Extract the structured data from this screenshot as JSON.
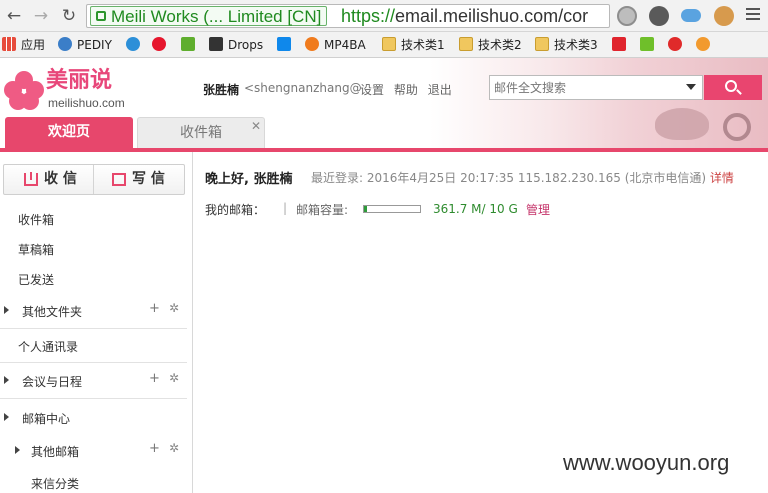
{
  "browser": {
    "ev_badge": "Meili Works (... Limited [CN]",
    "url_https": "https://",
    "url_rest": "email.meilishuo.com/cor"
  },
  "bookmarks": [
    {
      "label": "应用",
      "icon": "apps-grid-icon"
    },
    {
      "label": "PEDIY",
      "icon": "snowflake-icon"
    },
    {
      "label": "",
      "icon": "ip-icon"
    },
    {
      "label": "",
      "icon": "weibo-icon"
    },
    {
      "label": "",
      "icon": "f-icon"
    },
    {
      "label": "Drops",
      "icon": "drops-icon"
    },
    {
      "label": "",
      "icon": "zhihu-icon"
    },
    {
      "label": "MP4BA",
      "icon": "play-icon"
    },
    {
      "label": "技术类1",
      "icon": "folder-icon"
    },
    {
      "label": "技术类2",
      "icon": "folder-icon"
    },
    {
      "label": "技术类3",
      "icon": "folder-icon"
    }
  ],
  "header": {
    "logo_cn": "美丽说",
    "logo_en": "meilishuo.com",
    "user_name": "张胜楠",
    "user_email": "<shengnanzhang@",
    "links": [
      "设置",
      "帮助",
      "退出"
    ],
    "search_placeholder": "邮件全文搜索"
  },
  "tabs": [
    {
      "label": "欢迎页",
      "active": true
    },
    {
      "label": "收件箱",
      "active": false
    }
  ],
  "sidebar": {
    "receive": "收 信",
    "write": "写 信",
    "items": [
      {
        "label": "收件箱"
      },
      {
        "label": "草稿箱"
      },
      {
        "label": "已发送"
      },
      {
        "label": "其他文件夹"
      },
      {
        "label": "个人通讯录"
      },
      {
        "label": "会议与日程"
      },
      {
        "label": "邮箱中心"
      },
      {
        "label": "其他邮箱"
      },
      {
        "label": "来信分类"
      }
    ]
  },
  "main": {
    "greeting": "晚上好, 张胜楠",
    "last_login": "最近登录: 2016年4月25日 20:17:35 115.182.230.165 (北京市电信通)",
    "detail_link": "详情",
    "mailbox_label": "我的邮箱：",
    "capacity_label": "邮箱容量:",
    "capacity_used_fraction": 0.036,
    "capacity_text": "361.7 M/ 10 G",
    "manage": "管理"
  },
  "watermark": "www.wooyun.org",
  "colors": {
    "brand": "#e7476c",
    "ev_green": "#1f8a1f"
  }
}
